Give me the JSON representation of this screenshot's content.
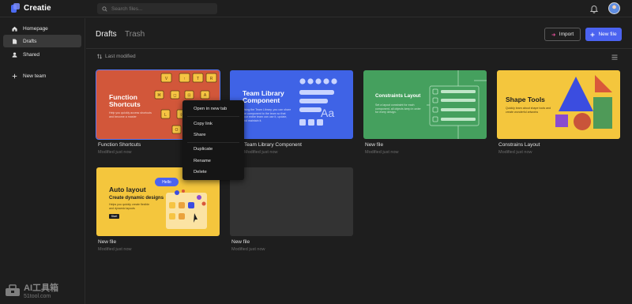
{
  "app": {
    "name": "Creatie"
  },
  "search": {
    "placeholder": "Search files..."
  },
  "sidebar": {
    "items": [
      {
        "label": "Homepage",
        "icon": "home-icon",
        "active": false
      },
      {
        "label": "Drafts",
        "icon": "file-icon",
        "active": true
      },
      {
        "label": "Shared",
        "icon": "user-icon",
        "active": false
      },
      {
        "label": "New team",
        "icon": "plus-icon",
        "active": false
      }
    ]
  },
  "header": {
    "tabs": [
      {
        "label": "Drafts",
        "active": true
      },
      {
        "label": "Trash",
        "active": false
      }
    ],
    "import_label": "Import",
    "new_file_label": "New file",
    "sort_label": "Last modified"
  },
  "colors": {
    "accent": "#4b63f0",
    "selection": "#5b78f5"
  },
  "cards": [
    {
      "name": "Function Shortcuts",
      "subtitle": "Modified just now",
      "thumb": {
        "title_line1": "Function",
        "title_line2": "Shortcuts",
        "desc": "Help you quickly access shortcuts and become a master",
        "bg": "#d2573a"
      }
    },
    {
      "name": "Team Library Component",
      "subtitle": "Modified just now",
      "thumb": {
        "title_line1": "Team Library",
        "title_line2": "Component",
        "desc": "Using the Team Library, you can share the component to the team so that your entire team can use it, update, and maintain it.",
        "glyph": "Aa",
        "bg": "#3f63e6"
      }
    },
    {
      "name": "New file",
      "subtitle": "Modified just now",
      "thumb": {
        "title": "Constraints Layout",
        "desc": "Set a layout constraint for each component, all objects keep in order for every design.",
        "bg": "#45a05e"
      }
    },
    {
      "name": "Constrains Layout",
      "subtitle": "Modified just now",
      "thumb": {
        "title": "Shape Tools",
        "desc": "Quickly learn about shape tools and create wonderful artworks",
        "bg": "#f4c63d"
      }
    },
    {
      "name": "New file",
      "subtitle": "Modified just now",
      "thumb": {
        "title_line1": "Auto layout",
        "title_line2": "Create dynamic designs",
        "desc": "Helps you quickly create flexible and dynamic layouts",
        "chip": "Hello",
        "button": "Start",
        "bg": "#f4c63d"
      }
    },
    {
      "name": "New file",
      "subtitle": "Modified just now",
      "thumb": {
        "bg": "#333333"
      }
    }
  ],
  "context_menu": {
    "items": [
      "Open in new tab",
      "Copy link",
      "Share",
      "Duplicate",
      "Rename",
      "Delete"
    ]
  },
  "watermark": {
    "line1": "AI工具箱",
    "line2": "51tool.com"
  }
}
